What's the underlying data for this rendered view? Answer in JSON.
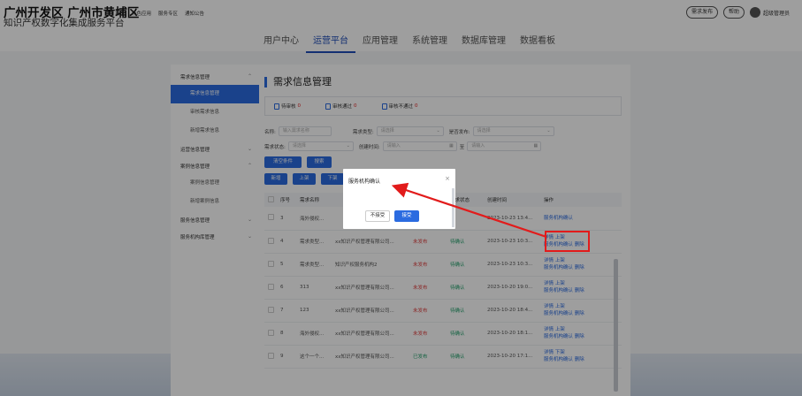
{
  "header": {
    "brand_title": "广州开发区 广州市黄埔区",
    "brand_subtitle": "知识产权数字化集成服务平台",
    "top_links": [
      "首页",
      "特色应用",
      "服务专区",
      "通知公告"
    ],
    "publish_button": "需求发布",
    "help_button": "帮助",
    "user_name": "超级管理员"
  },
  "main_nav": {
    "items": [
      "用户中心",
      "运营平台",
      "应用管理",
      "系统管理",
      "数据库管理",
      "数据看板"
    ],
    "active": "运营平台"
  },
  "sidebar": {
    "groups": [
      {
        "label": "需求信息管理",
        "items": [
          "需求信息管理",
          "审核需求信息",
          "新增需求信息"
        ]
      },
      {
        "label": "运营信息管理",
        "items": []
      },
      {
        "label": "案例信息管理",
        "items": [
          "案例信息管理",
          "新增案例信息"
        ]
      },
      {
        "label": "服务信息管理",
        "items": []
      },
      {
        "label": "服务机构库管理",
        "items": []
      }
    ],
    "active_item": "需求信息管理"
  },
  "page": {
    "title": "需求信息管理",
    "stats": [
      {
        "label": "待审核",
        "count": "0"
      },
      {
        "label": "审核通过",
        "count": "0"
      },
      {
        "label": "审核不通过",
        "count": "0"
      }
    ]
  },
  "filters": {
    "name_label": "名称:",
    "name_placeholder": "输入需求名称",
    "type_label": "需求类型:",
    "type_placeholder": "请选择",
    "published_label": "是否发布:",
    "published_placeholder": "请选择",
    "status_label": "需求状态:",
    "status_placeholder": "请选择",
    "created_label": "创建时间:",
    "date_start_placeholder": "请输入",
    "date_end_placeholder": "请输入",
    "date_sep": "至",
    "clear_button": "清空条件",
    "search_button": "搜索"
  },
  "toolbar": {
    "add": "新增",
    "up": "上架",
    "down": "下架"
  },
  "table": {
    "columns": [
      "序号",
      "需求名称",
      "",
      "",
      "需求状态",
      "创建时间",
      "操作"
    ],
    "rows": [
      {
        "no": "3",
        "name": "海外侵权...",
        "org": "",
        "publish": "",
        "status": "",
        "time": "2023-10-23 13:4...",
        "actions": [
          "服务机构确认"
        ]
      },
      {
        "no": "4",
        "name": "需求类型...",
        "org": "xx知识产权管理有限公司...",
        "publish": "未发布",
        "status": "待确认",
        "time": "2023-10-23 10:3...",
        "actions": [
          "详情",
          "上架",
          "服务机构确认",
          "删除"
        ]
      },
      {
        "no": "5",
        "name": "需求类型...",
        "org": "知识产权服务机构2",
        "publish": "未发布",
        "status": "待确认",
        "time": "2023-10-23 10:3...",
        "actions": [
          "详情",
          "上架",
          "服务机构确认",
          "删除"
        ]
      },
      {
        "no": "6",
        "name": "313",
        "org": "xx知识产权管理有限公司...",
        "publish": "未发布",
        "status": "待确认",
        "time": "2023-10-20 19:0...",
        "actions": [
          "详情",
          "上架",
          "服务机构确认",
          "删除"
        ]
      },
      {
        "no": "7",
        "name": "123",
        "org": "xx知识产权管理有限公司...",
        "publish": "未发布",
        "status": "待确认",
        "time": "2023-10-20 18:4...",
        "actions": [
          "详情",
          "上架",
          "服务机构确认",
          "删除"
        ]
      },
      {
        "no": "8",
        "name": "海外侵权...",
        "org": "xx知识产权管理有限公司...",
        "publish": "未发布",
        "status": "待确认",
        "time": "2023-10-20 18:1...",
        "actions": [
          "详情",
          "上架",
          "服务机构确认",
          "删除"
        ]
      },
      {
        "no": "9",
        "name": "这个一个...",
        "org": "xx知识产权管理有限公司...",
        "publish": "已发布",
        "status": "待确认",
        "time": "2023-10-20 17:1...",
        "actions": [
          "详情",
          "下架",
          "服务机构确认",
          "删除"
        ]
      }
    ]
  },
  "dialog": {
    "title": "服务机构确认",
    "reject_button": "不接受",
    "accept_button": "接受"
  },
  "colors": {
    "accent": "#2b6be0",
    "annotation": "#e21b1b",
    "unpublished": "#e04040",
    "published": "#22a06b"
  }
}
